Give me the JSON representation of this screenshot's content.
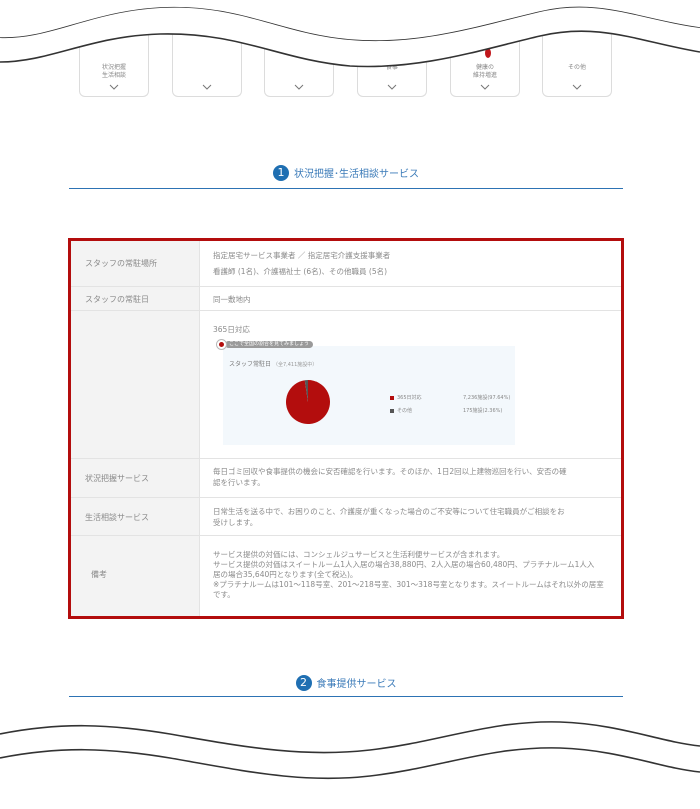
{
  "nav": {
    "tabs": [
      {
        "label": "状況把握\n生活相談",
        "icon": ""
      },
      {
        "label": "",
        "icon": ""
      },
      {
        "label": "",
        "icon": ""
      },
      {
        "label": "食事",
        "icon": "meal-icon"
      },
      {
        "label": "健康の\n維持増進",
        "icon": "footprint-icon"
      },
      {
        "label": "その他",
        "icon": ""
      }
    ]
  },
  "sections": [
    {
      "number": "1",
      "title": "状況把握･生活相談サービス"
    },
    {
      "number": "2",
      "title": "食事提供サービス"
    }
  ],
  "table": {
    "rows": [
      {
        "label": "スタッフの常駐場所",
        "lines": [
          "指定居宅サービス事業者 ／ 指定居宅介護支援事業者",
          "看護師 (1名)、介護福祉士 (6名)、その他職員 (5名)"
        ]
      },
      {
        "label": "スタッフの常駐日",
        "lines": [
          "同一敷地内"
        ]
      },
      {
        "label": "",
        "lines": [
          "365日対応"
        ]
      },
      {
        "label": "状況把握サービス",
        "lines": [
          "毎日ゴミ回収や食事提供の機会に安否確認を行います。そのほか、1日2回以上建物巡回を行い、安否の確",
          "認を行います。"
        ]
      },
      {
        "label": "生活相談サービス",
        "lines": [
          "日常生活を送る中で、お困りのこと、介護度が重くなった場合のご不安等について住宅職員がご相談をお",
          "受けします。"
        ]
      },
      {
        "label": "備考",
        "lines": [
          "サービス提供の対価には、コンシェルジュサービスと生活利便サービスが含まれます。",
          "サービス提供の対価はスイートルーム1人入居の場合38,880円、2人入居の場合60,480円、プラチナルーム1人入",
          "居の場合35,640円となります(全て税込)。",
          "※プラチナルームは101～118号室、201～218号室、301～318号室となります。スイートルームはそれ以外の居室",
          "です。"
        ]
      }
    ]
  },
  "chart": {
    "hint": "ここで全国の割合を見てみましょう",
    "title": "スタッフ常駐日",
    "subtitle": "（全7,411施設中）"
  },
  "chart_data": {
    "type": "pie",
    "title": "スタッフ常駐日",
    "series": [
      {
        "name": "365日対応",
        "label": "7,236施設(97.64%)",
        "value": 7236,
        "percent": 97.64,
        "color": "#b30d0d"
      },
      {
        "name": "その他",
        "label": "175施設(2.36%)",
        "value": 175,
        "percent": 2.36,
        "color": "#555555"
      }
    ],
    "legend": "right"
  },
  "colors": {
    "accent": "#1f6fb2",
    "highlight_border": "#b30d0d"
  }
}
